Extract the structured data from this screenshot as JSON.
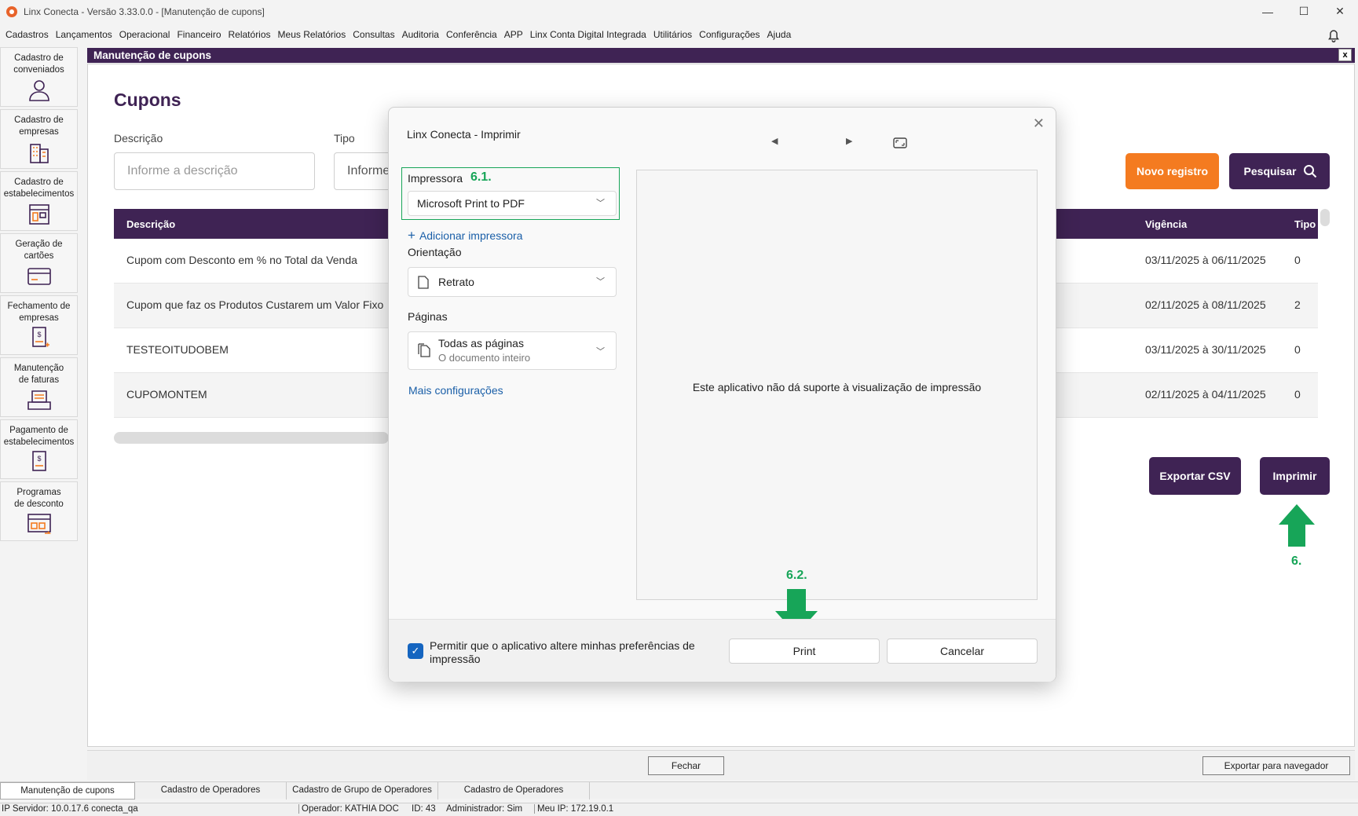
{
  "window": {
    "title": "Linx Conecta - Versão 3.33.0.0 - [Manutenção de cupons]",
    "minimize": "—",
    "maximize": "☐",
    "close": "✕"
  },
  "menu": [
    "Cadastros",
    "Lançamentos",
    "Operacional",
    "Financeiro",
    "Relatórios",
    "Meus Relatórios",
    "Consultas",
    "Auditoria",
    "Conferência",
    "APP",
    "Linx Conta Digital Integrada",
    "Utilitários",
    "Configurações",
    "Ajuda"
  ],
  "sidebar": [
    {
      "label": "Cadastro de\nconveniados",
      "icon": "user-icon"
    },
    {
      "label": "Cadastro de\nempresas",
      "icon": "building-icon"
    },
    {
      "label": "Cadastro de\nestabelecimentos",
      "icon": "store-icon"
    },
    {
      "label": "Geração de\ncartões",
      "icon": "card-icon"
    },
    {
      "label": "Fechamento de\nempresas",
      "icon": "invoice-icon"
    },
    {
      "label": "Manutenção\nde faturas",
      "icon": "tray-icon"
    },
    {
      "label": "Pagamento de\nestabelecimentos",
      "icon": "payment-icon"
    },
    {
      "label": "Programas\nde desconto",
      "icon": "discount-icon"
    }
  ],
  "main": {
    "header": "Manutenção de cupons",
    "close": "x",
    "title": "Cupons",
    "filters": {
      "descricao_label": "Descrição",
      "descricao_placeholder": "Informe a descrição",
      "tipo_label": "Tipo",
      "tipo_placeholder": "Informe"
    },
    "buttons": {
      "novo": "Novo registro",
      "pesquisar": "Pesquisar",
      "exportar_csv": "Exportar CSV",
      "imprimir": "Imprimir"
    },
    "table": {
      "columns": [
        "Descrição",
        "Vigência",
        "Tipo"
      ],
      "rows": [
        {
          "descricao": "Cupom com Desconto em % no Total da Venda",
          "vigencia": "03/11/2025 à 06/11/2025",
          "tipo": "0"
        },
        {
          "descricao": "Cupom que faz os Produtos Custarem um Valor Fixo",
          "vigencia": "02/11/2025 à 08/11/2025",
          "tipo": "2"
        },
        {
          "descricao": "TESTEOITUDOBEM",
          "vigencia": "03/11/2025 à 30/11/2025",
          "tipo": "0"
        },
        {
          "descricao": "CUPOMONTEM",
          "vigencia": "02/11/2025 à 04/11/2025",
          "tipo": "0"
        }
      ]
    }
  },
  "annotations": {
    "step6": "6.",
    "step61": "6.1.",
    "step62": "6.2.",
    "arrow_color": "#17a558"
  },
  "dialog": {
    "title": "Linx Conecta - Imprimir",
    "close": "✕",
    "printer_label": "Impressora",
    "printer_value": "Microsoft Print to PDF",
    "add_printer": "Adicionar impressora",
    "orientation_label": "Orientação",
    "orientation_value": "Retrato",
    "pages_label": "Páginas",
    "pages_value": "Todas as páginas",
    "pages_sub": "O documento inteiro",
    "more_settings": "Mais configurações",
    "preview_message": "Este aplicativo não dá suporte à visualização de impressão",
    "checkbox_label": "Permitir que o aplicativo altere minhas preferências de impressão",
    "checkbox_checked": true,
    "print": "Print",
    "cancel": "Cancelar"
  },
  "bottom": {
    "fechar": "Fechar",
    "exportar_navegador": "Exportar para navegador"
  },
  "tabs": [
    "Manutenção de cupons",
    "Cadastro de Operadores",
    "Cadastro de Grupo de Operadores",
    "Cadastro de Operadores"
  ],
  "status": {
    "servidor": "IP Servidor: 10.0.17.6 conecta_qa",
    "operador": "Operador: KATHIA DOC",
    "id": "ID: 43",
    "admin": "Administrador: Sim",
    "ip": "Meu IP: 172.19.0.1"
  },
  "colors": {
    "brand_purple": "#3f2354",
    "accent_orange": "#f47b20",
    "link_blue": "#1a5fa8"
  }
}
